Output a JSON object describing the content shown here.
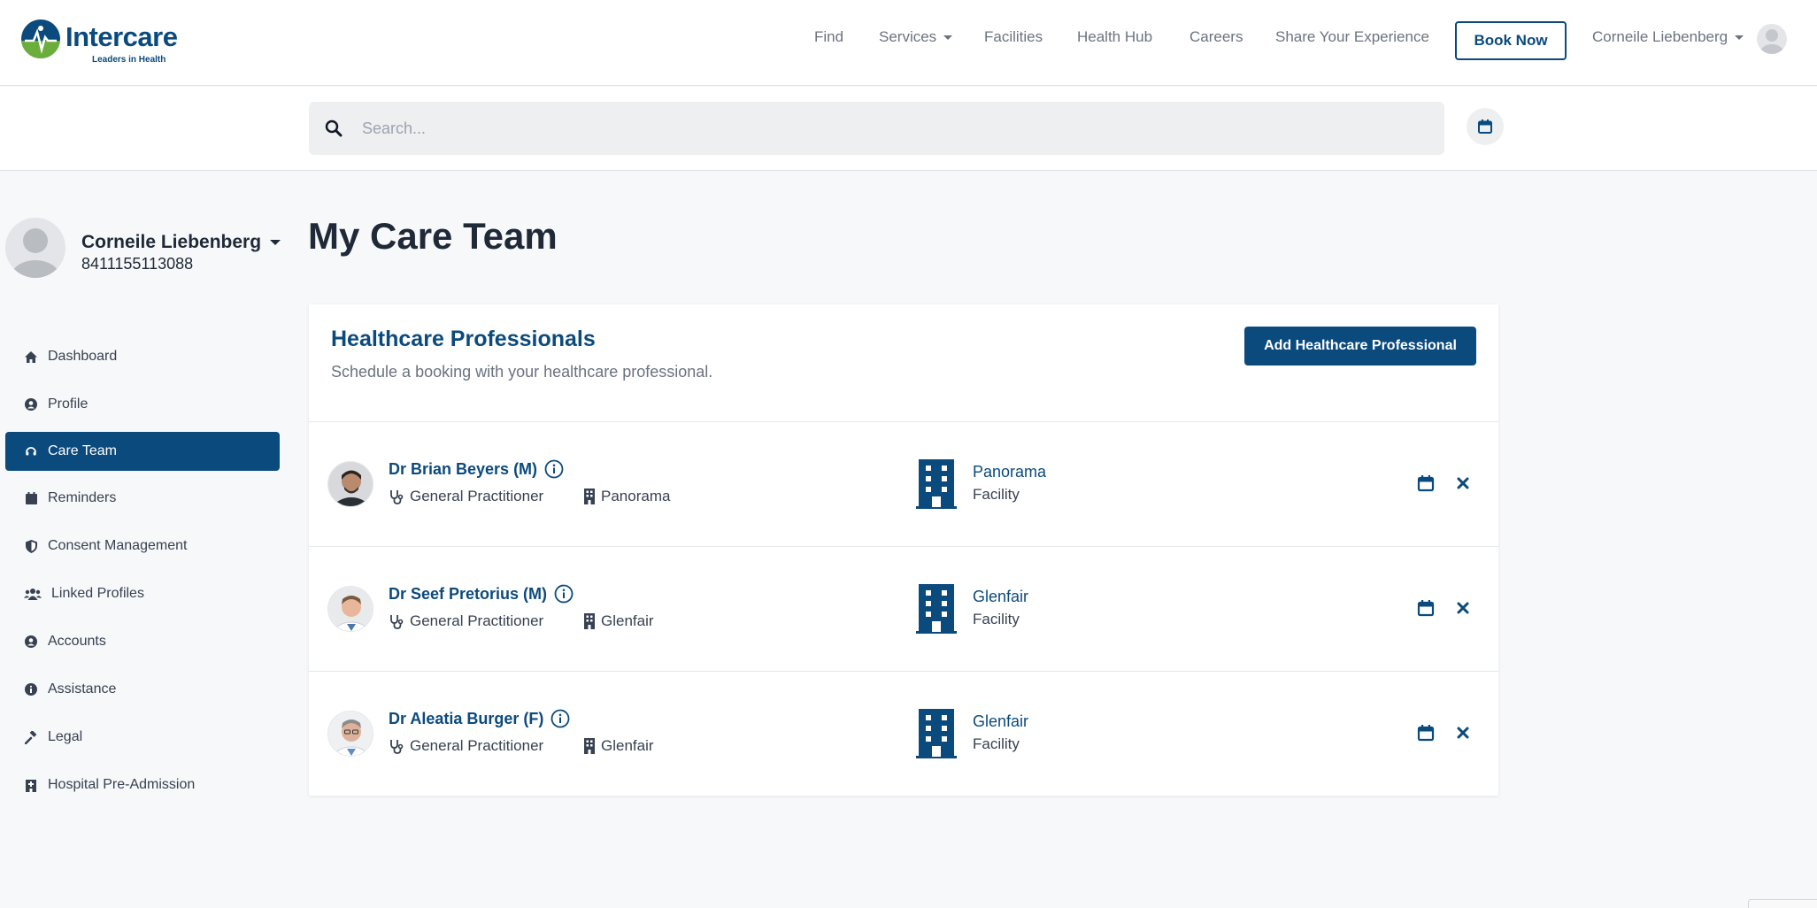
{
  "brand": {
    "name": "Intercare",
    "tagline": "Leaders in Health",
    "primary_color": "#0b4a7d",
    "accent_color": "#6cae3b"
  },
  "nav": {
    "items": [
      {
        "label": "Find"
      },
      {
        "label": "Services"
      },
      {
        "label": "Facilities"
      },
      {
        "label": "Health Hub"
      },
      {
        "label": "Careers"
      },
      {
        "label": "Share Your Experience"
      }
    ],
    "book_now": "Book Now",
    "user_name": "Corneile Liebenberg"
  },
  "search": {
    "placeholder": "Search..."
  },
  "profile": {
    "name": "Corneile Liebenberg",
    "id_number": "8411155113088"
  },
  "sidebar": {
    "items": [
      {
        "label": "Dashboard",
        "icon": "home-icon"
      },
      {
        "label": "Profile",
        "icon": "user-circle-icon"
      },
      {
        "label": "Care Team",
        "icon": "headset-icon",
        "active": true
      },
      {
        "label": "Reminders",
        "icon": "calendar-icon"
      },
      {
        "label": "Consent Management",
        "icon": "shield-icon"
      },
      {
        "label": "Linked Profiles",
        "icon": "users-icon"
      },
      {
        "label": "Accounts",
        "icon": "user-circle-icon"
      },
      {
        "label": "Assistance",
        "icon": "info-icon"
      },
      {
        "label": "Legal",
        "icon": "gavel-icon"
      },
      {
        "label": "Hospital Pre-Admission",
        "icon": "hospital-icon"
      }
    ]
  },
  "main": {
    "title": "My Care Team",
    "card": {
      "title": "Healthcare Professionals",
      "subtitle": "Schedule a booking with your healthcare professional.",
      "add_button": "Add Healthcare Professional"
    },
    "professionals": [
      {
        "name": "Dr Brian Beyers (M)",
        "specialty": "General Practitioner",
        "facility": "Panorama",
        "facility_label": "Facility"
      },
      {
        "name": "Dr Seef Pretorius (M)",
        "specialty": "General Practitioner",
        "facility": "Glenfair",
        "facility_label": "Facility"
      },
      {
        "name": "Dr Aleatia Burger (F)",
        "specialty": "General Practitioner",
        "facility": "Glenfair",
        "facility_label": "Facility"
      }
    ]
  }
}
